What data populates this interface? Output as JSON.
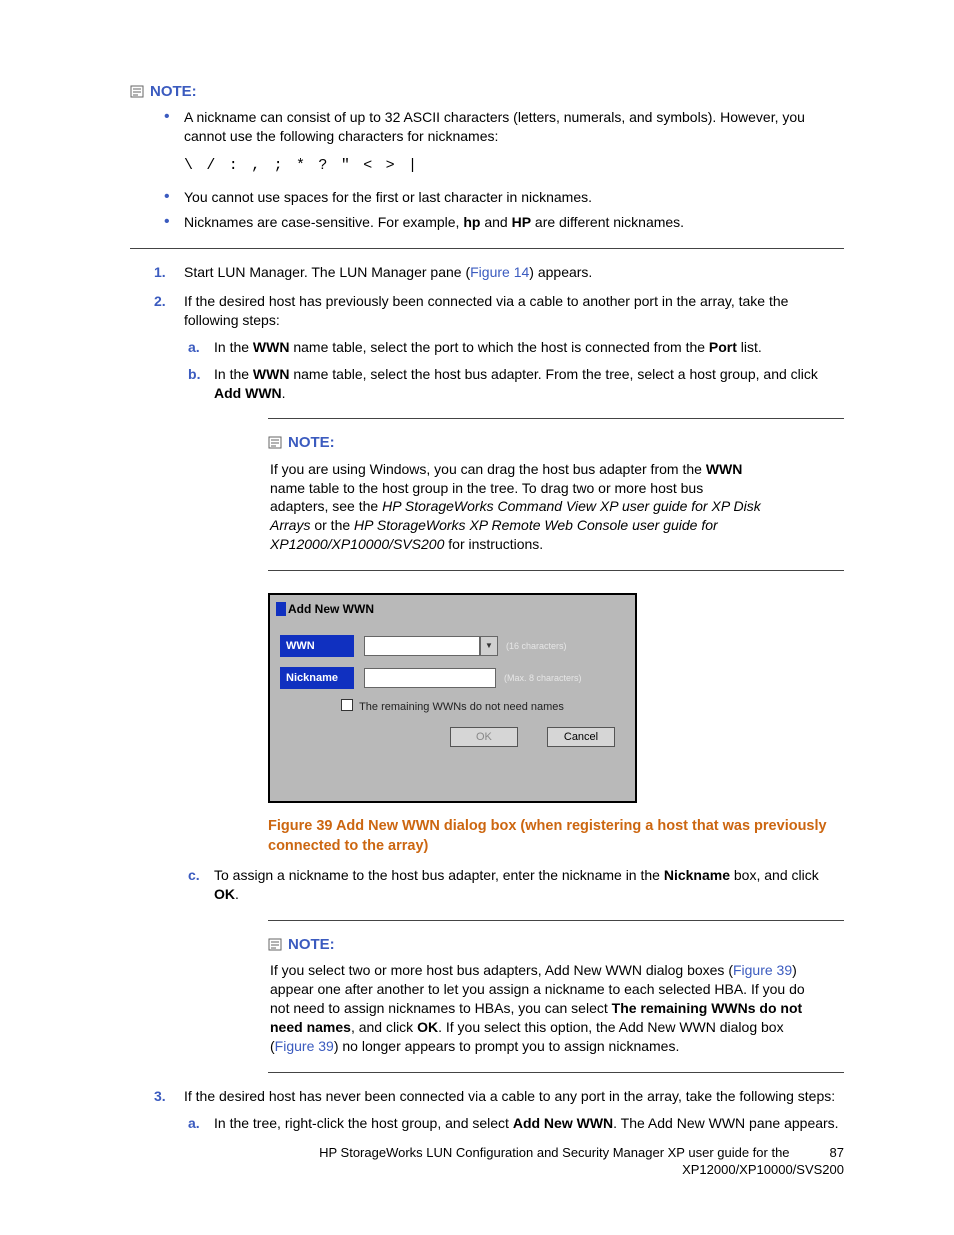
{
  "note1": {
    "label": "NOTE:",
    "bullet1": "A nickname can consist of up to 32 ASCII characters (letters, numerals, and symbols). However, you cannot use the following characters for nicknames:",
    "chars": "\\ / : , ; * ? \" < > |",
    "bullet2": "You cannot use spaces for the first or last character in nicknames.",
    "bullet3_a": "Nicknames are case-sensitive. For example, ",
    "bullet3_b": "hp",
    "bullet3_c": " and ",
    "bullet3_d": "HP",
    "bullet3_e": " are different nicknames."
  },
  "step1": {
    "a": "Start LUN Manager. The LUN Manager pane (",
    "link": "Figure 14",
    "b": ") appears."
  },
  "step2": {
    "intro": "If the desired host has previously been connected via a cable to another port in the array, take the following steps:",
    "a1": "In the ",
    "a2": "WWN",
    "a3": " name table, select the port to which the host is connected from the ",
    "a4": "Port",
    "a5": " list.",
    "b1": "In the ",
    "b2": "WWN",
    "b3": " name table, select the host bus adapter. From the tree, select a host group, and click ",
    "b4": "Add WWN",
    "b5": "."
  },
  "subnote1": {
    "label": "NOTE:",
    "t1": "If you are using Windows, you can drag the host bus adapter from the ",
    "t2": "WWN",
    "t3": " name table to the host group in the tree. To drag two or more host bus adapters, see the ",
    "i1": "HP StorageWorks Command View XP user guide for XP Disk Arrays",
    "t4": " or the ",
    "i2": "HP StorageWorks XP Remote Web Console user guide for XP12000/XP10000/SVS200",
    "t5": " for instructions."
  },
  "dialog": {
    "title": "Add New WWN",
    "wwn_label": "WWN",
    "wwn_hint": "(16 characters)",
    "nick_label": "Nickname",
    "nick_hint": "(Max. 8 characters)",
    "check": "The remaining WWNs do not need names",
    "ok": "OK",
    "cancel": "Cancel"
  },
  "figcap": "Figure 39 Add New WWN dialog box (when registering a host that was previously connected to the array)",
  "step2c": {
    "a": "To assign a nickname to the host bus adapter, enter the nickname in the ",
    "b": "Nickname",
    "c": " box, and click ",
    "d": "OK",
    "e": "."
  },
  "subnote2": {
    "label": "NOTE:",
    "t1": "If you select two or more host bus adapters, Add New WWN dialog boxes (",
    "l1": "Figure 39",
    "t2": ") appear one after another to let you assign a nickname to each selected HBA. If you do not need to assign nicknames to HBAs, you can select ",
    "b1": "The remaining WWNs do not need names",
    "t3": ", and click ",
    "b2": "OK",
    "t4": ". If you select this option, the Add New WWN dialog box (",
    "l2": "Figure 39",
    "t5": ") no longer appears to prompt you to assign nicknames."
  },
  "step3": {
    "intro": "If the desired host has never been connected via a cable to any port in the array, take the following steps:",
    "a1": "In the tree, right-click the host group, and select ",
    "a2": "Add New WWN",
    "a3": ". The Add New WWN pane appears."
  },
  "footer": {
    "line1": "HP StorageWorks LUN Configuration and Security Manager XP user guide for the",
    "line2": "XP12000/XP10000/SVS200",
    "page": "87"
  }
}
